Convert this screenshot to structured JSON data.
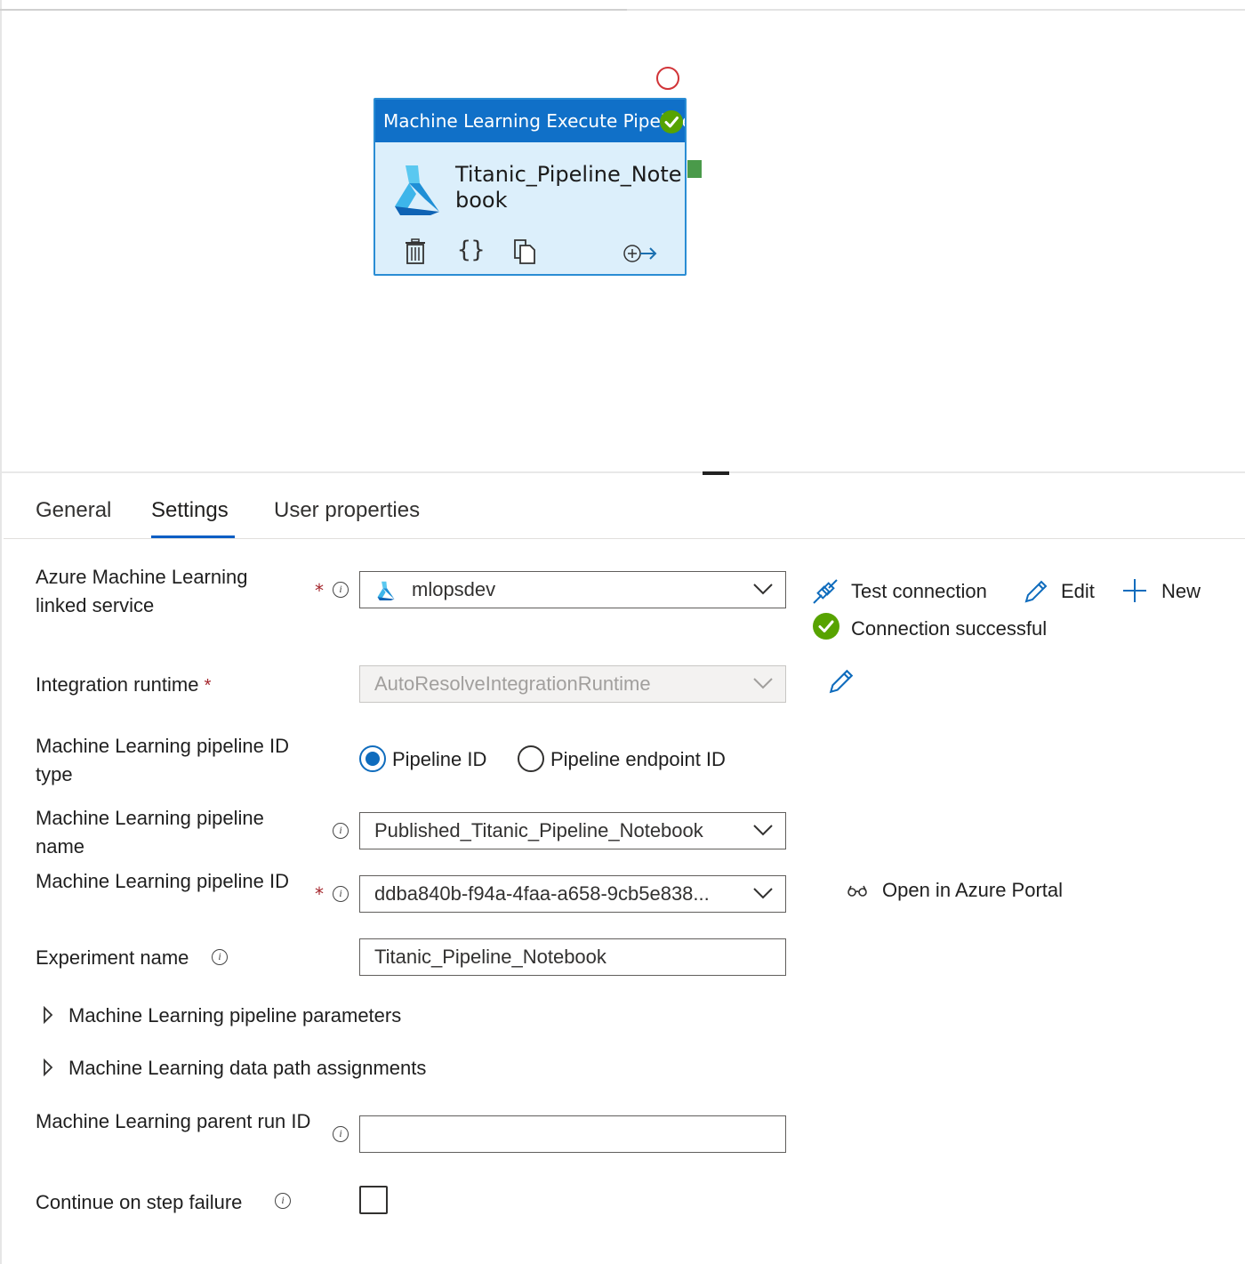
{
  "activity": {
    "header": "Machine Learning Execute Pipeline",
    "name": "Titanic_Pipeline_Notebook"
  },
  "tabs": [
    "General",
    "Settings",
    "User properties"
  ],
  "form": {
    "linked_service": {
      "label": "Azure Machine Learning linked service",
      "required": "*",
      "value": "mlopsdev"
    },
    "actions": {
      "test": "Test connection",
      "edit": "Edit",
      "new": "New",
      "status": "Connection successful"
    },
    "runtime": {
      "label": "Integration runtime",
      "required": "*",
      "value": "AutoResolveIntegrationRuntime"
    },
    "pipeline_id_type": {
      "label": "Machine Learning pipeline ID type",
      "options": [
        "Pipeline ID",
        "Pipeline endpoint ID"
      ],
      "selected": "Pipeline ID"
    },
    "pipeline_name": {
      "label": "Machine Learning pipeline name",
      "value": "Published_Titanic_Pipeline_Notebook"
    },
    "pipeline_id": {
      "label": "Machine Learning pipeline ID",
      "required": "*",
      "value": "ddba840b-f94a-4faa-a658-9cb5e838...",
      "portal_link": "Open in Azure Portal"
    },
    "experiment": {
      "label": "Experiment name",
      "value": "Titanic_Pipeline_Notebook"
    },
    "sections": [
      "Machine Learning pipeline parameters",
      "Machine Learning data path assignments"
    ],
    "parent_run": {
      "label": "Machine Learning parent run ID",
      "value": ""
    },
    "continue_on_failure": {
      "label": "Continue on step failure",
      "checked": false
    }
  },
  "colors": {
    "accent": "#0f6cbd",
    "header": "#1070c8",
    "success": "#57a300",
    "required": "#a4262c"
  }
}
